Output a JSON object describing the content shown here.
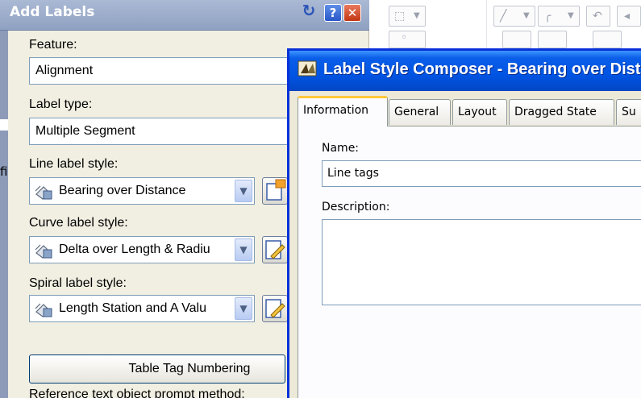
{
  "add_labels": {
    "title": "Add Labels",
    "feature_label": "Feature:",
    "feature_value": "Alignment",
    "label_type_label": "Label type:",
    "label_type_value": "Multiple Segment",
    "line_label_style_label": "Line label style:",
    "line_label_style_value": "Bearing over Distance",
    "curve_label_style_label": "Curve label style:",
    "curve_label_style_value": "Delta over Length & Radiu",
    "spiral_label_style_label": "Spiral label style:",
    "spiral_label_style_value": "Length Station and A Valu",
    "table_tag_button": "Table Tag Numbering",
    "reference_prompt_label": "Reference text object prompt method:",
    "left_edge_char": "fi"
  },
  "composer": {
    "title": "Label Style Composer - Bearing over Dist",
    "tabs": [
      {
        "label": "Information",
        "active": true
      },
      {
        "label": "General",
        "active": false
      },
      {
        "label": "Layout",
        "active": false
      },
      {
        "label": "Dragged State",
        "active": false
      },
      {
        "label": "Su",
        "active": false
      }
    ],
    "name_label": "Name:",
    "name_value": "Line tags",
    "description_label": "Description:",
    "description_value": ""
  },
  "icons": {
    "palette": [
      "pin-icon",
      "help-icon",
      "close-icon",
      "label-style-icon",
      "edit-style-icon"
    ],
    "toolbar": [
      "layer-dropdown-icon",
      "line-tool-icon",
      "curve-tool-icon",
      "undo-icon"
    ]
  },
  "colors": {
    "xp_title_blue": "#0054e3",
    "palette_title": "#8fa1c2",
    "active_tab_accent": "#ffc83c",
    "close_red": "#c23714"
  }
}
